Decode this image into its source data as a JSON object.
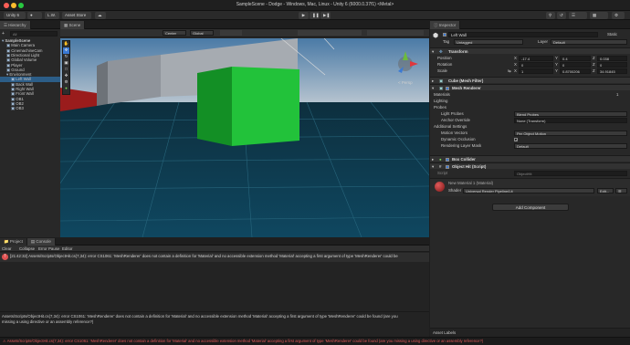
{
  "window": {
    "title": "SampleScene - Dodge - Windows, Mac, Linux - Unity 6 (6000.0.37f1) <Metal>",
    "app": "Unity 6"
  },
  "toolbar": {
    "account": "L.W.",
    "asset_store": "Asset Store"
  },
  "hierarchy": {
    "tab": "Hierarchy",
    "search_placeholder": "All",
    "items": [
      {
        "label": "SampleScene",
        "indent": 0
      },
      {
        "label": "Main Camera",
        "indent": 1
      },
      {
        "label": "CinemachineCam",
        "indent": 1
      },
      {
        "label": "Directional Light",
        "indent": 1
      },
      {
        "label": "Global Volume",
        "indent": 1
      },
      {
        "label": "Player",
        "indent": 1
      },
      {
        "label": "Ground",
        "indent": 1
      },
      {
        "label": "Environment",
        "indent": 1
      },
      {
        "label": "Left Wall",
        "indent": 2
      },
      {
        "label": "Back Wall",
        "indent": 2
      },
      {
        "label": "Right Wall",
        "indent": 2
      },
      {
        "label": "Front Wall",
        "indent": 2
      },
      {
        "label": "OB1",
        "indent": 2
      },
      {
        "label": "OB2",
        "indent": 2
      },
      {
        "label": "OB3",
        "indent": 2
      }
    ]
  },
  "scene": {
    "tab": "Scene",
    "center": "Center",
    "global": "Global",
    "persp": "< Persp"
  },
  "console": {
    "tabs": [
      "Project",
      "Console"
    ],
    "toolbar": [
      "Clear",
      "Collapse",
      "Error Pause",
      "Editor"
    ],
    "error1": "[21:42:32] Assets/Scripts/ObjectHit.cs(7,34): error CS1061: 'MeshRenderer' does not contain a definition for 'Material' and no accessible extension method 'Material' accepting a first argument of type 'MeshRenderer' could be",
    "detail1": "Assets/Scripts/ObjectHit.cs(7,34): error CS1061: 'MeshRenderer' does not contain a definition for 'Material' and no accessible extension method 'Material' accepting a first argument of type 'MeshRenderer' could be found (are you",
    "detail2": "missing a using directive or an assembly reference?)",
    "statusbar": "Assets/Scripts/ObjectHit.cs(7,34): error CS1061: 'MeshRenderer' does not contain a definition for 'Material' and no accessible extension method 'Material' accepting a first argument of type 'MeshRenderer' could be found (are you missing a using directive or an assembly reference?)"
  },
  "inspector": {
    "tab": "Inspector",
    "object_name": "Left Wall",
    "static": "Static",
    "tag_label": "Tag",
    "tag": "Untagged",
    "layer_label": "Layer",
    "layer": "Default",
    "transform": {
      "title": "Transform",
      "position": "Position",
      "rotation": "Rotation",
      "scale": "Scale",
      "px": "-17.4",
      "py": "0.4",
      "pz": "0.038",
      "rx": "0",
      "ry": "0",
      "rz": "0",
      "sx": "1",
      "sy": "0.8700206",
      "sz": "34.91845"
    },
    "mesh_filter": "Cube (Mesh Filter)",
    "mesh_renderer": "Mesh Renderer",
    "materials": "Materials",
    "materials_count": "1",
    "lighting": "Lighting",
    "probes": "Probes",
    "light_probes": "Light Probes",
    "light_probes_val": "Blend Probes",
    "anchor_override": "Anchor Override",
    "anchor_override_val": "None (Transform)",
    "additional_settings": "Additional Settings",
    "motion_vectors": "Motion Vectors",
    "motion_vectors_val": "Per Object Motion",
    "dynamic_occlusion": "Dynamic Occlusion",
    "rendering_layer_mask": "Rendering Layer Mask",
    "rendering_layer_mask_val": "Default",
    "box_collider": "Box Collider",
    "object_hit": "Object Hit (Script)",
    "script_label": "Script",
    "script_val": "ObjectHit",
    "material_name": "New Material 1 (Material)",
    "shader_label": "Shader",
    "shader_val": "Universal Render Pipeline/Lit",
    "edit": "Edit...",
    "add_component": "Add Component",
    "asset_labels": "Asset Labels"
  },
  "colors": {
    "error": "#ff5555",
    "accent": "#3a79d4",
    "green_cube": "#22c23a",
    "water": "#0e3a4f"
  }
}
